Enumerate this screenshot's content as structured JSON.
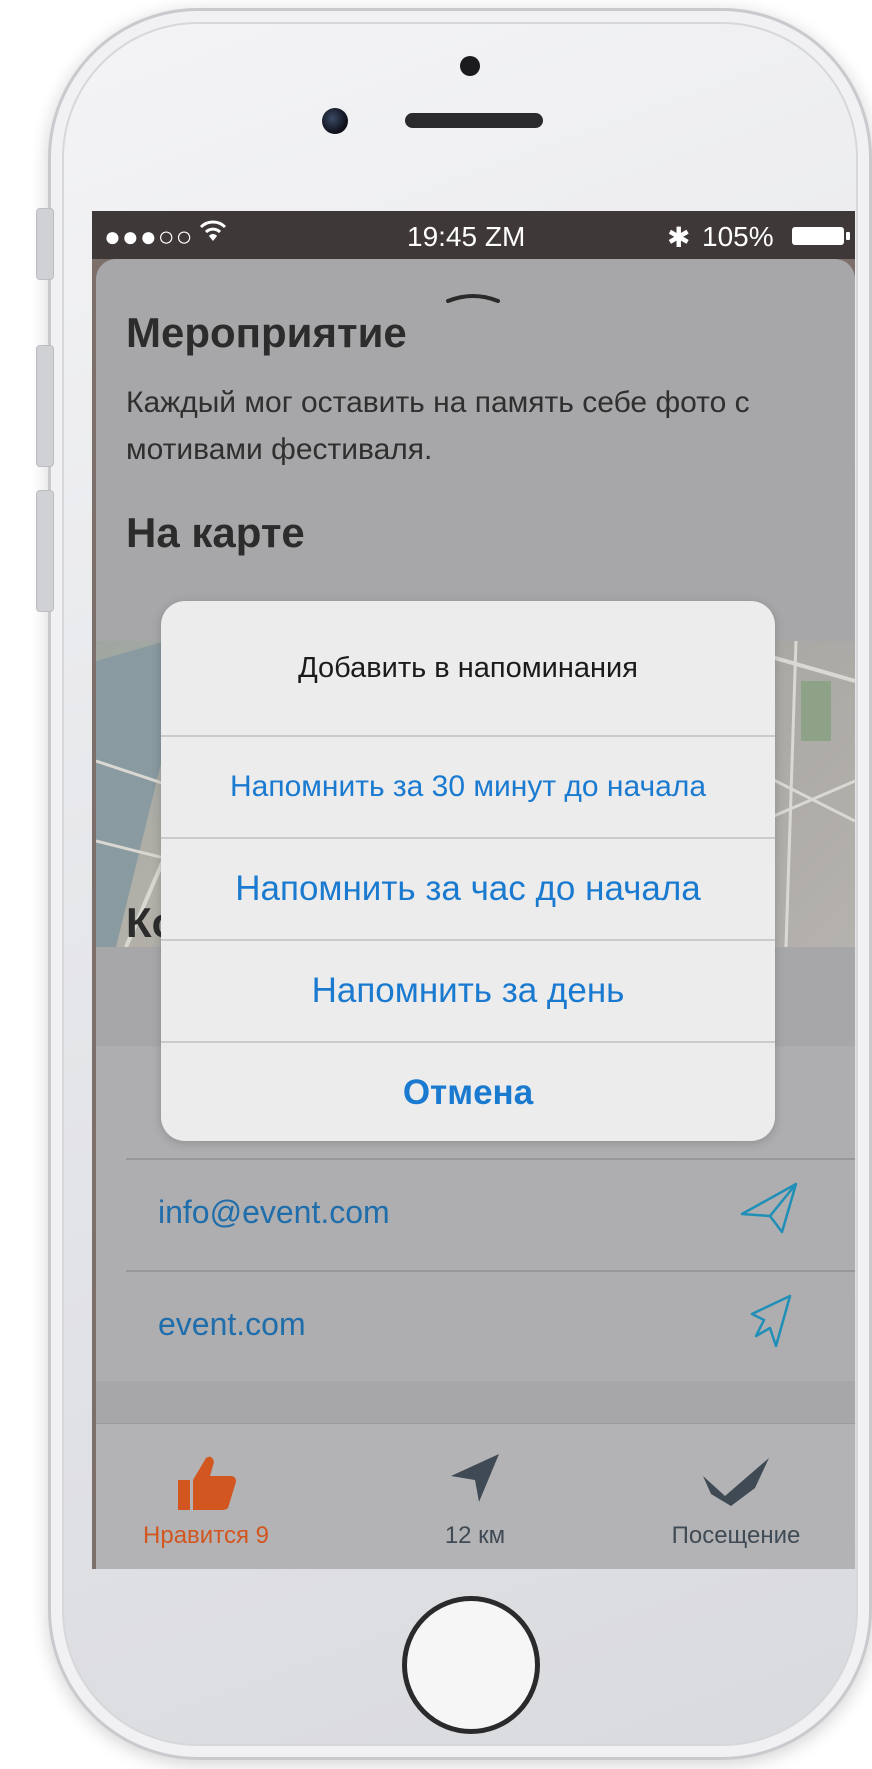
{
  "status_bar": {
    "signal": "●●●○○",
    "wifi_icon": "wifi-icon",
    "time": "19:45 ZM",
    "bluetooth": "✱",
    "battery": "105%"
  },
  "event": {
    "section_title": "Мероприятие",
    "description": "Каждый мог оставить на память себе фото с мотивами фестиваля.",
    "map_title": "На карте",
    "contacts_title_partial": "Ко"
  },
  "contacts": [
    {
      "text": "info@event.com",
      "icon": "send-icon"
    },
    {
      "text": "event.com",
      "icon": "cursor-arrow-icon"
    }
  ],
  "tabbar": {
    "likes_label": "Нравится 9",
    "distance_label": "12 км",
    "visit_label": "Посещение",
    "active_color": "#d2561f",
    "inactive_color": "#3f4a55"
  },
  "alert": {
    "title": "Добавить в напоминания",
    "options": [
      "Напомнить за 30 минут до начала",
      "Напомнить за час до начала",
      "Напомнить за день"
    ],
    "cancel": "Отмена",
    "accent_color": "#1a7ad0"
  }
}
